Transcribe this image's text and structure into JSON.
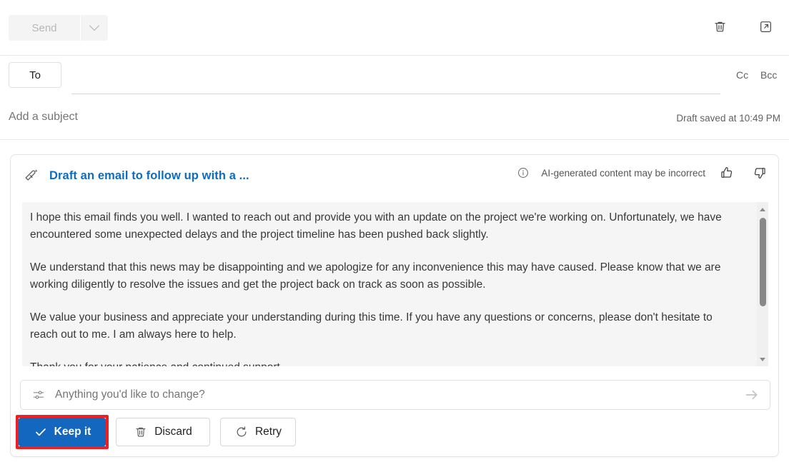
{
  "toolbar": {
    "send_label": "Send",
    "send_dropdown_icon": "chevron-down-icon",
    "discard_icon": "trash-icon",
    "popout_icon": "open-in-new-window-icon"
  },
  "compose": {
    "to_label": "To",
    "to_value": "",
    "cc_label": "Cc",
    "bcc_label": "Bcc",
    "subject_placeholder": "Add a subject",
    "subject_value": "",
    "draft_status": "Draft saved at 10:49 PM"
  },
  "copilot": {
    "icon": "copilot-draft-pen-icon",
    "title": "Draft an email to follow up with a ...",
    "info_icon": "info-circle-icon",
    "ai_disclaimer": "AI-generated content may be incorrect",
    "thumbs_up_icon": "thumbs-up-icon",
    "thumbs_down_icon": "thumbs-down-icon",
    "draft_paragraphs": [
      "I hope this email finds you well. I wanted to reach out and provide you with an update on the project we're working on. Unfortunately, we have encountered some unexpected delays and the project timeline has been pushed back slightly.",
      "We understand that this news may be disappointing and we apologize for any inconvenience this may have caused. Please know that we are working diligently to resolve the issues and get the project back on track as soon as possible.",
      "We value your business and appreciate your understanding during this time. If you have any questions or concerns, please don't hesitate to reach out to me. I am always here to help.",
      "Thank you for your patience and continued support."
    ],
    "refine": {
      "icon": "sliders-icon",
      "placeholder": "Anything you'd like to change?",
      "value": "",
      "submit_icon": "arrow-right-icon"
    },
    "actions": {
      "keep_label": "Keep it",
      "keep_icon": "checkmark-icon",
      "discard_label": "Discard",
      "discard_icon": "trash-icon",
      "retry_label": "Retry",
      "retry_icon": "refresh-icon"
    }
  },
  "colors": {
    "accent_blue": "#1367bf",
    "link_blue": "#0f6cbd",
    "highlight_red": "#ec2024",
    "draft_bg": "#f5f5f5"
  }
}
